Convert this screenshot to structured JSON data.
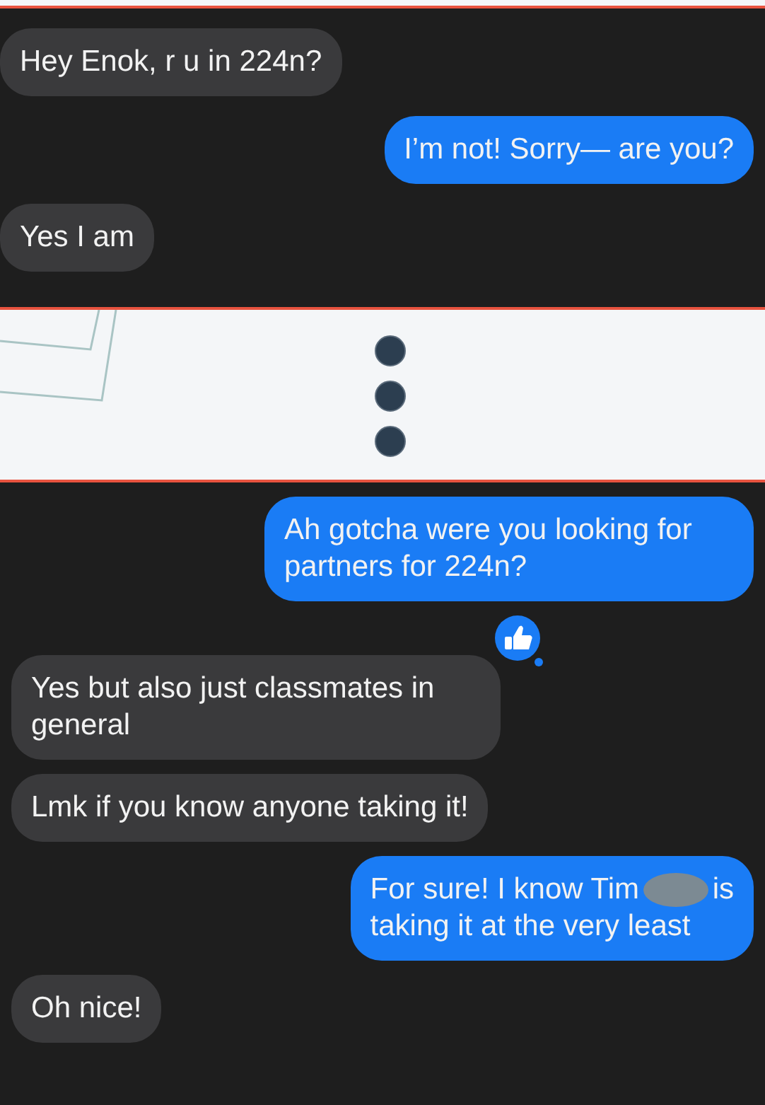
{
  "top_panel": {
    "messages": [
      {
        "kind": "incoming",
        "text": "Hey Enok, r u in 224n?"
      },
      {
        "kind": "outgoing",
        "text": "I’m not! Sorry— are you?"
      },
      {
        "kind": "incoming",
        "text": "Yes I am"
      }
    ]
  },
  "gap": {
    "kind": "ellipsis"
  },
  "bottom_panel": {
    "messages": [
      {
        "kind": "outgoing",
        "text": "Ah gotcha were you looking for partners for 224n?"
      },
      {
        "kind": "incoming",
        "text": "Yes but also just classmates in general",
        "liked": true
      },
      {
        "kind": "incoming",
        "text": "Lmk if you know anyone taking it!"
      },
      {
        "kind": "outgoing",
        "text": "For sure! I know Tim",
        "redacted": true,
        "text_after": "is",
        "text_line_2": "taking it at the very least"
      },
      {
        "kind": "incoming",
        "text": "Oh nice!"
      }
    ]
  }
}
